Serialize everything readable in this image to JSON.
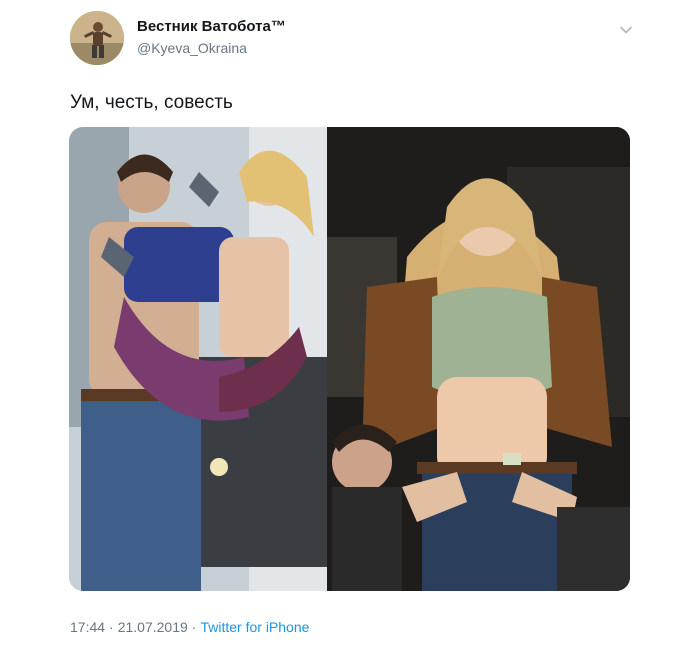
{
  "author": {
    "display_name": "Вестник Ватобота™",
    "handle": "@Kyeva_Okraina"
  },
  "tweet": {
    "text": "Ум, честь, совесть"
  },
  "meta": {
    "time": "17:44",
    "date": "21.07.2019",
    "separator": "·",
    "source": "Twitter for iPhone"
  },
  "colors": {
    "name": "#14171a",
    "secondary": "#657786",
    "link": "#1b95e0"
  },
  "icons": {
    "menu": "chevron-down-icon"
  }
}
